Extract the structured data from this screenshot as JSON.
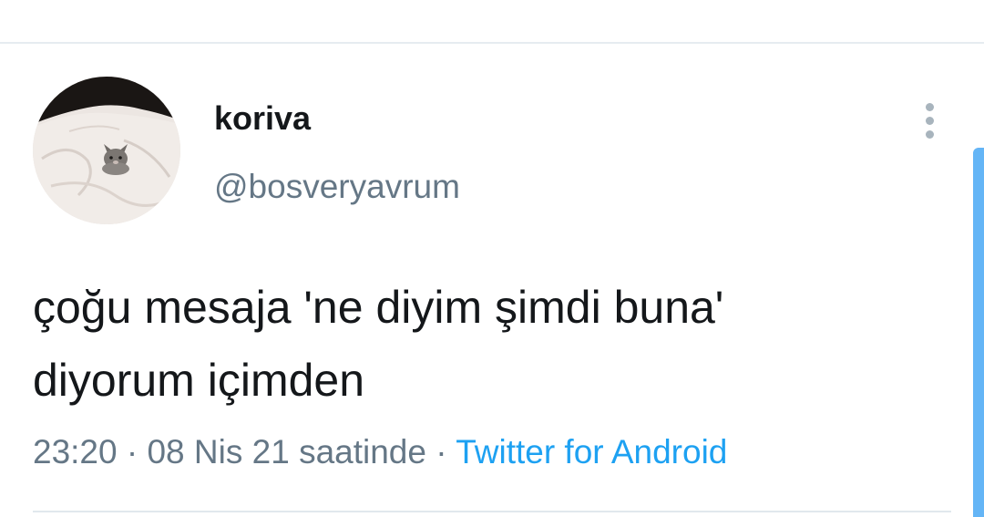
{
  "tweet": {
    "author": {
      "display_name": "koriva",
      "handle": "@bosveryavrum",
      "avatar": "kitten-on-white-blanket"
    },
    "text_lines": [
      "çoğu mesaja 'ne diyim şimdi buna'",
      "diyorum içimden"
    ],
    "meta": {
      "time": "23:20",
      "separator": " · ",
      "date": "08 Nis 21",
      "suffix": " saatinde",
      "separator2": " · ",
      "source": "Twitter for Android"
    },
    "more_icon": "vertical-ellipsis-icon"
  },
  "colors": {
    "text_primary": "#14171a",
    "text_secondary": "#657786",
    "link": "#1da1f2",
    "scroll_indicator": "#64b5f6"
  }
}
